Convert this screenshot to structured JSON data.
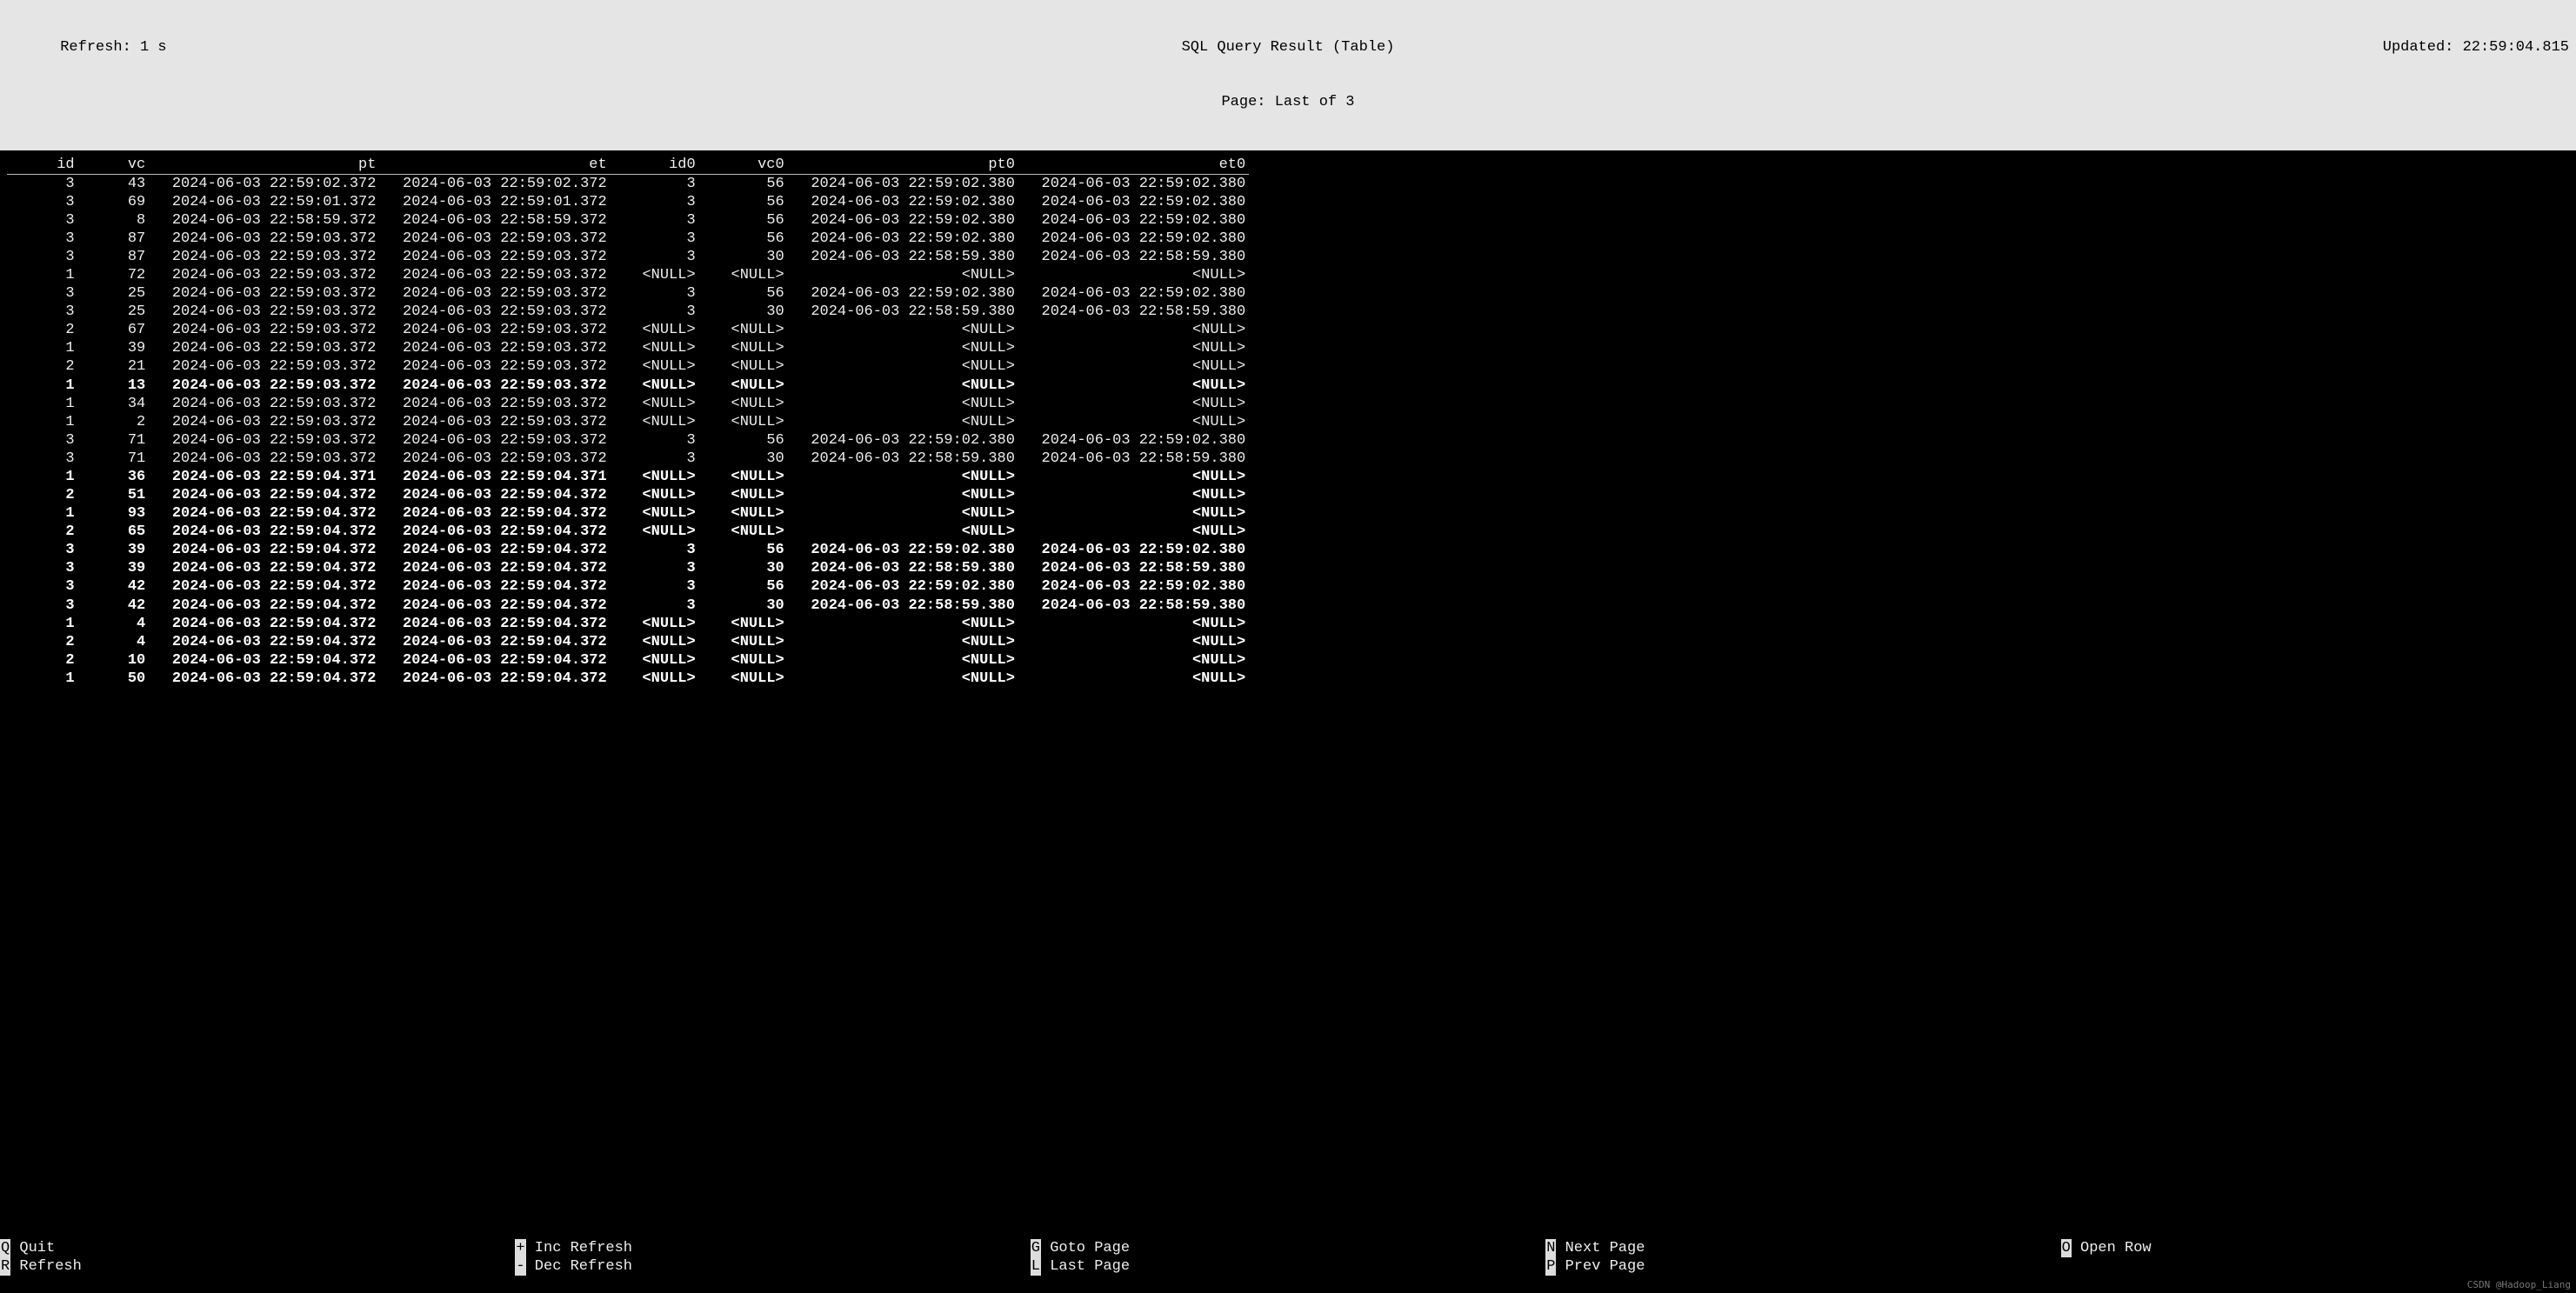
{
  "status": {
    "refresh_label": "Refresh: 1 s",
    "title": "SQL Query Result (Table)",
    "page_label": "Page: Last of 3",
    "updated_label": "Updated: 22:59:04.815"
  },
  "columns": [
    "id",
    "vc",
    "pt",
    "et",
    "id0",
    "vc0",
    "pt0",
    "et0"
  ],
  "rows": [
    {
      "id": "3",
      "vc": "43",
      "pt": "2024-06-03 22:59:02.372",
      "et": "2024-06-03 22:59:02.372",
      "id0": "3",
      "vc0": "56",
      "pt0": "2024-06-03 22:59:02.380",
      "et0": "2024-06-03 22:59:02.380",
      "b": false
    },
    {
      "id": "3",
      "vc": "69",
      "pt": "2024-06-03 22:59:01.372",
      "et": "2024-06-03 22:59:01.372",
      "id0": "3",
      "vc0": "56",
      "pt0": "2024-06-03 22:59:02.380",
      "et0": "2024-06-03 22:59:02.380",
      "b": false
    },
    {
      "id": "3",
      "vc": "8",
      "pt": "2024-06-03 22:58:59.372",
      "et": "2024-06-03 22:58:59.372",
      "id0": "3",
      "vc0": "56",
      "pt0": "2024-06-03 22:59:02.380",
      "et0": "2024-06-03 22:59:02.380",
      "b": false
    },
    {
      "id": "3",
      "vc": "87",
      "pt": "2024-06-03 22:59:03.372",
      "et": "2024-06-03 22:59:03.372",
      "id0": "3",
      "vc0": "56",
      "pt0": "2024-06-03 22:59:02.380",
      "et0": "2024-06-03 22:59:02.380",
      "b": false
    },
    {
      "id": "3",
      "vc": "87",
      "pt": "2024-06-03 22:59:03.372",
      "et": "2024-06-03 22:59:03.372",
      "id0": "3",
      "vc0": "30",
      "pt0": "2024-06-03 22:58:59.380",
      "et0": "2024-06-03 22:58:59.380",
      "b": false
    },
    {
      "id": "1",
      "vc": "72",
      "pt": "2024-06-03 22:59:03.372",
      "et": "2024-06-03 22:59:03.372",
      "id0": "<NULL>",
      "vc0": "<NULL>",
      "pt0": "<NULL>",
      "et0": "<NULL>",
      "b": false
    },
    {
      "id": "3",
      "vc": "25",
      "pt": "2024-06-03 22:59:03.372",
      "et": "2024-06-03 22:59:03.372",
      "id0": "3",
      "vc0": "56",
      "pt0": "2024-06-03 22:59:02.380",
      "et0": "2024-06-03 22:59:02.380",
      "b": false
    },
    {
      "id": "3",
      "vc": "25",
      "pt": "2024-06-03 22:59:03.372",
      "et": "2024-06-03 22:59:03.372",
      "id0": "3",
      "vc0": "30",
      "pt0": "2024-06-03 22:58:59.380",
      "et0": "2024-06-03 22:58:59.380",
      "b": false
    },
    {
      "id": "2",
      "vc": "67",
      "pt": "2024-06-03 22:59:03.372",
      "et": "2024-06-03 22:59:03.372",
      "id0": "<NULL>",
      "vc0": "<NULL>",
      "pt0": "<NULL>",
      "et0": "<NULL>",
      "b": false
    },
    {
      "id": "1",
      "vc": "39",
      "pt": "2024-06-03 22:59:03.372",
      "et": "2024-06-03 22:59:03.372",
      "id0": "<NULL>",
      "vc0": "<NULL>",
      "pt0": "<NULL>",
      "et0": "<NULL>",
      "b": false
    },
    {
      "id": "2",
      "vc": "21",
      "pt": "2024-06-03 22:59:03.372",
      "et": "2024-06-03 22:59:03.372",
      "id0": "<NULL>",
      "vc0": "<NULL>",
      "pt0": "<NULL>",
      "et0": "<NULL>",
      "b": false
    },
    {
      "id": "1",
      "vc": "13",
      "pt": "2024-06-03 22:59:03.372",
      "et": "2024-06-03 22:59:03.372",
      "id0": "<NULL>",
      "vc0": "<NULL>",
      "pt0": "<NULL>",
      "et0": "<NULL>",
      "b": true
    },
    {
      "id": "1",
      "vc": "34",
      "pt": "2024-06-03 22:59:03.372",
      "et": "2024-06-03 22:59:03.372",
      "id0": "<NULL>",
      "vc0": "<NULL>",
      "pt0": "<NULL>",
      "et0": "<NULL>",
      "b": false
    },
    {
      "id": "1",
      "vc": "2",
      "pt": "2024-06-03 22:59:03.372",
      "et": "2024-06-03 22:59:03.372",
      "id0": "<NULL>",
      "vc0": "<NULL>",
      "pt0": "<NULL>",
      "et0": "<NULL>",
      "b": false
    },
    {
      "id": "3",
      "vc": "71",
      "pt": "2024-06-03 22:59:03.372",
      "et": "2024-06-03 22:59:03.372",
      "id0": "3",
      "vc0": "56",
      "pt0": "2024-06-03 22:59:02.380",
      "et0": "2024-06-03 22:59:02.380",
      "b": false
    },
    {
      "id": "3",
      "vc": "71",
      "pt": "2024-06-03 22:59:03.372",
      "et": "2024-06-03 22:59:03.372",
      "id0": "3",
      "vc0": "30",
      "pt0": "2024-06-03 22:58:59.380",
      "et0": "2024-06-03 22:58:59.380",
      "b": false
    },
    {
      "id": "1",
      "vc": "36",
      "pt": "2024-06-03 22:59:04.371",
      "et": "2024-06-03 22:59:04.371",
      "id0": "<NULL>",
      "vc0": "<NULL>",
      "pt0": "<NULL>",
      "et0": "<NULL>",
      "b": true
    },
    {
      "id": "2",
      "vc": "51",
      "pt": "2024-06-03 22:59:04.372",
      "et": "2024-06-03 22:59:04.372",
      "id0": "<NULL>",
      "vc0": "<NULL>",
      "pt0": "<NULL>",
      "et0": "<NULL>",
      "b": true
    },
    {
      "id": "1",
      "vc": "93",
      "pt": "2024-06-03 22:59:04.372",
      "et": "2024-06-03 22:59:04.372",
      "id0": "<NULL>",
      "vc0": "<NULL>",
      "pt0": "<NULL>",
      "et0": "<NULL>",
      "b": true
    },
    {
      "id": "2",
      "vc": "65",
      "pt": "2024-06-03 22:59:04.372",
      "et": "2024-06-03 22:59:04.372",
      "id0": "<NULL>",
      "vc0": "<NULL>",
      "pt0": "<NULL>",
      "et0": "<NULL>",
      "b": true
    },
    {
      "id": "3",
      "vc": "39",
      "pt": "2024-06-03 22:59:04.372",
      "et": "2024-06-03 22:59:04.372",
      "id0": "3",
      "vc0": "56",
      "pt0": "2024-06-03 22:59:02.380",
      "et0": "2024-06-03 22:59:02.380",
      "b": true
    },
    {
      "id": "3",
      "vc": "39",
      "pt": "2024-06-03 22:59:04.372",
      "et": "2024-06-03 22:59:04.372",
      "id0": "3",
      "vc0": "30",
      "pt0": "2024-06-03 22:58:59.380",
      "et0": "2024-06-03 22:58:59.380",
      "b": true
    },
    {
      "id": "3",
      "vc": "42",
      "pt": "2024-06-03 22:59:04.372",
      "et": "2024-06-03 22:59:04.372",
      "id0": "3",
      "vc0": "56",
      "pt0": "2024-06-03 22:59:02.380",
      "et0": "2024-06-03 22:59:02.380",
      "b": true
    },
    {
      "id": "3",
      "vc": "42",
      "pt": "2024-06-03 22:59:04.372",
      "et": "2024-06-03 22:59:04.372",
      "id0": "3",
      "vc0": "30",
      "pt0": "2024-06-03 22:58:59.380",
      "et0": "2024-06-03 22:58:59.380",
      "b": true
    },
    {
      "id": "1",
      "vc": "4",
      "pt": "2024-06-03 22:59:04.372",
      "et": "2024-06-03 22:59:04.372",
      "id0": "<NULL>",
      "vc0": "<NULL>",
      "pt0": "<NULL>",
      "et0": "<NULL>",
      "b": true
    },
    {
      "id": "2",
      "vc": "4",
      "pt": "2024-06-03 22:59:04.372",
      "et": "2024-06-03 22:59:04.372",
      "id0": "<NULL>",
      "vc0": "<NULL>",
      "pt0": "<NULL>",
      "et0": "<NULL>",
      "b": true
    },
    {
      "id": "2",
      "vc": "10",
      "pt": "2024-06-03 22:59:04.372",
      "et": "2024-06-03 22:59:04.372",
      "id0": "<NULL>",
      "vc0": "<NULL>",
      "pt0": "<NULL>",
      "et0": "<NULL>",
      "b": true
    },
    {
      "id": "1",
      "vc": "50",
      "pt": "2024-06-03 22:59:04.372",
      "et": "2024-06-03 22:59:04.372",
      "id0": "<NULL>",
      "vc0": "<NULL>",
      "pt0": "<NULL>",
      "et0": "<NULL>",
      "b": true
    }
  ],
  "help": [
    [
      {
        "key": "Q",
        "label": "Quit"
      },
      {
        "key": "R",
        "label": "Refresh"
      }
    ],
    [
      {
        "key": "+",
        "label": "Inc Refresh"
      },
      {
        "key": "-",
        "label": "Dec Refresh"
      }
    ],
    [
      {
        "key": "G",
        "label": "Goto Page"
      },
      {
        "key": "L",
        "label": "Last Page"
      }
    ],
    [
      {
        "key": "N",
        "label": "Next Page"
      },
      {
        "key": "P",
        "label": "Prev Page"
      }
    ],
    [
      {
        "key": "O",
        "label": "Open Row"
      }
    ]
  ],
  "watermark": "CSDN @Hadoop_Liang"
}
